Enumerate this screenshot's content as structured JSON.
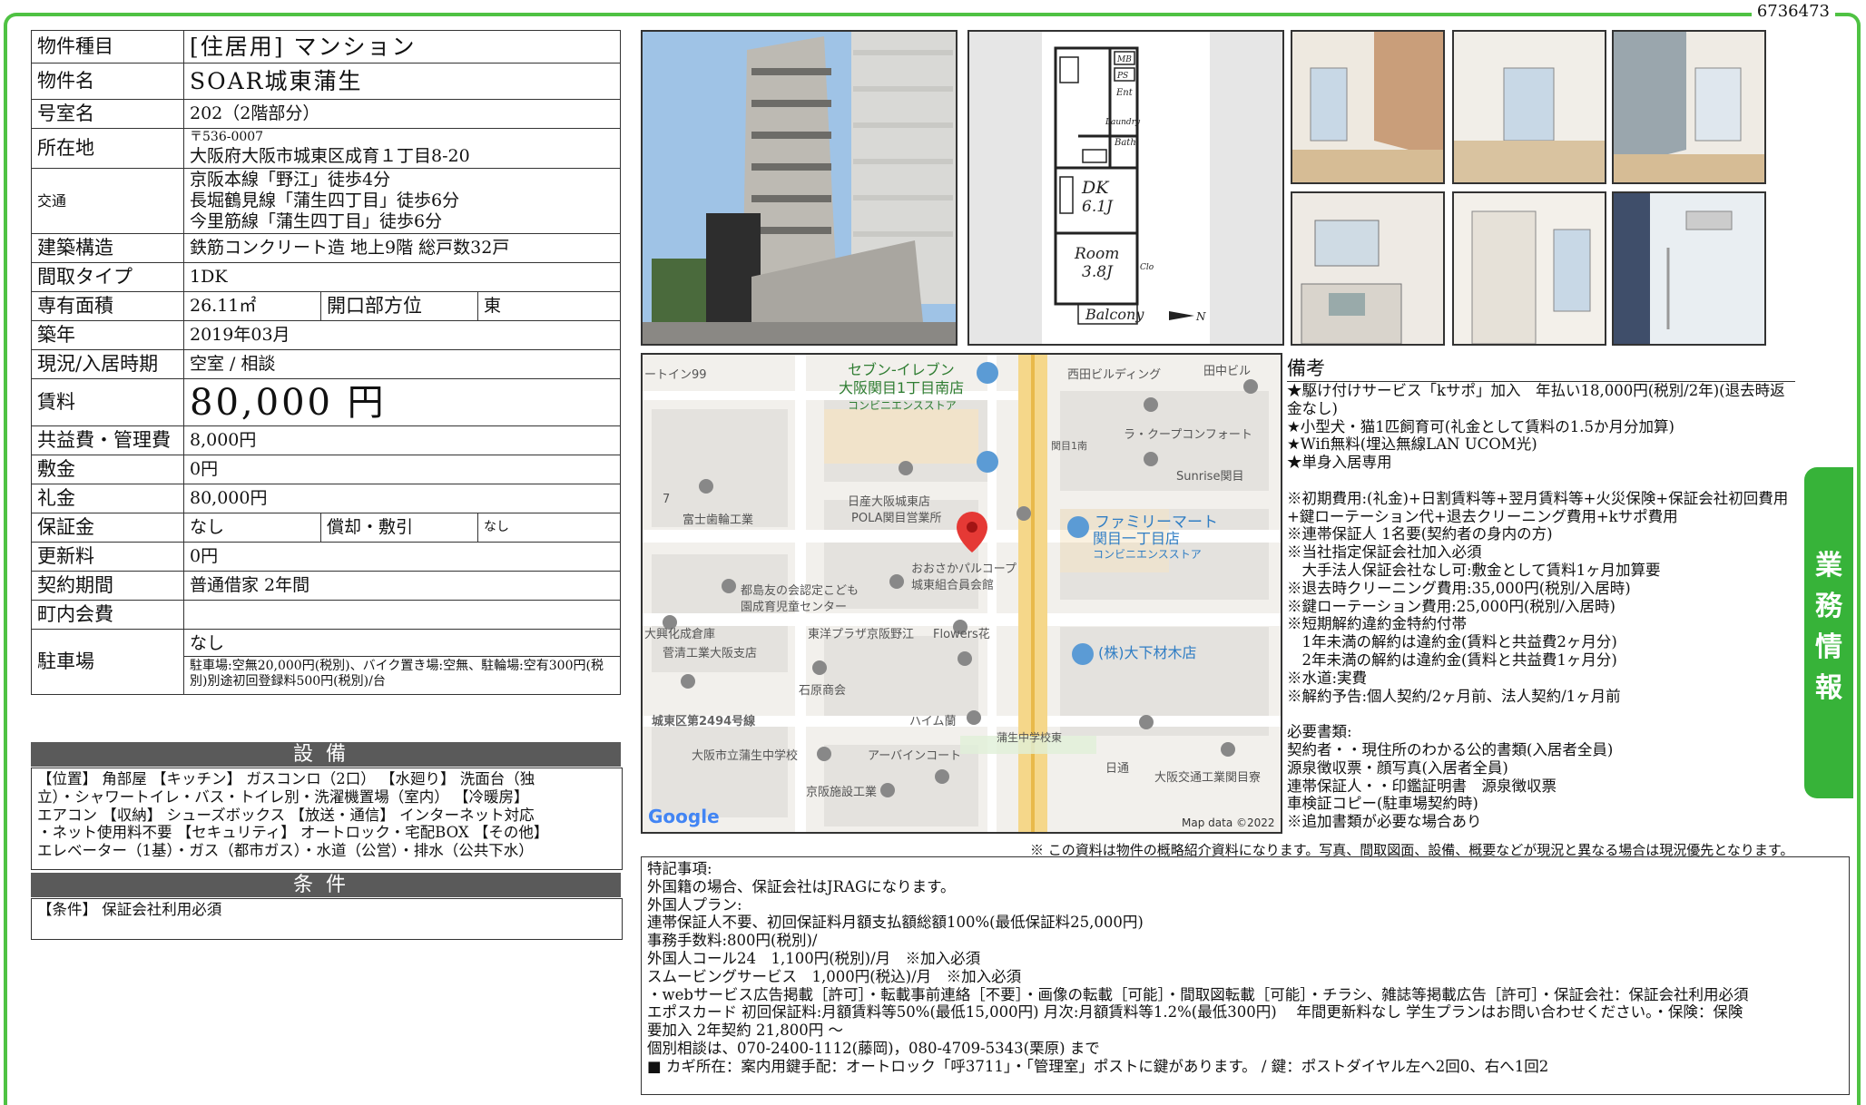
{
  "property_id": "6736473",
  "table": {
    "type_label": "物件種目",
    "type_value": "[住居用] マンション",
    "name_label": "物件名",
    "name_value": "SOAR城東蒲生",
    "room_label": "号室名",
    "room_value": "202（2階部分）",
    "addr_label": "所在地",
    "addr_zip": "〒536-0007",
    "addr_value": "大阪府大阪市城東区成育１丁目8-20",
    "traffic_label": "交通",
    "traffic_1": "京阪本線「野江」徒歩4分",
    "traffic_2": "長堀鶴見線「蒲生四丁目」徒歩6分",
    "traffic_3": "今里筋線「蒲生四丁目」徒歩6分",
    "struct_label": "建築構造",
    "struct_value": "鉄筋コンクリート造 地上9階 総戸数32戸",
    "layout_label": "間取タイプ",
    "layout_value": "1DK",
    "area_label": "専有面積",
    "area_value": "26.11㎡",
    "dir_label": "開口部方位",
    "dir_value": "東",
    "built_label": "築年",
    "built_value": "2019年03月",
    "status_label": "現況/入居時期",
    "status_value": "空室 / 相談",
    "rent_label": "賃料",
    "rent_value": "80,000 円",
    "fee_label": "共益費・管理費",
    "fee_value": "8,000円",
    "deposit_label": "敷金",
    "deposit_value": "0円",
    "key_label": "礼金",
    "key_value": "80,000円",
    "guar_label": "保証金",
    "guar_value": "なし",
    "amort_label": "償却・敷引",
    "amort_value": "なし",
    "renew_label": "更新料",
    "renew_value": "0円",
    "contract_label": "契約期間",
    "contract_value": "普通借家 2年間",
    "town_label": "町内会費",
    "town_value": "",
    "parking_label": "駐車場",
    "parking_value": "なし",
    "parking_detail": "駐車場:空無20,000円(税別)、バイク置き場:空無、駐輪場:空有300円(税別)別途初回登録料500円(税別)/台"
  },
  "equipment": {
    "title": "設備",
    "lines": [
      "【位置】 角部屋 【キッチン】 ガスコンロ（2口） 【水廻り】 洗面台（独",
      "立）・シャワートイレ・バス・トイレ別・洗濯機置場（室内） 【冷暖房】",
      "エアコン 【収納】 シューズボックス 【放送・通信】 インターネット対応",
      "・ネット使用料不要 【セキュリティ】 オートロック・宅配BOX 【その他】",
      "エレベーター（1基）・ガス（都市ガス）・水道（公営）・排水（公共下水）"
    ]
  },
  "conditions": {
    "title": "条件",
    "text": "【条件】 保証会社利用必須"
  },
  "floorplan": {
    "labels": [
      "MB",
      "PS",
      "Ent",
      "Laundry",
      "Bath",
      "DK",
      "6.1J",
      "Room",
      "3.8J",
      "Clo",
      "Balcony",
      "N"
    ]
  },
  "map": {
    "labels": [
      "ートイン99",
      "セブン-イレブン",
      "大阪関目1丁目南店",
      "コンビニエンスストア",
      "西田ビルディング",
      "田中ビル",
      "ラ・クープコンフォート",
      "関目1南",
      "Sunrise関目",
      "7",
      "日産大阪城東店",
      "POLA関目営業所",
      "富士歯輪工業",
      "ファミリーマート",
      "関目一丁目店",
      "コンビニエンスストア",
      "おおさかパルコープ",
      "城東組合員会館",
      "都島友の会認定こども",
      "園成育児童センター",
      "大興化成倉庫",
      "東洋プラザ京阪野江",
      "Flowers花",
      "菅清工業大阪支店",
      "(株)大下材木店",
      "石原商会",
      "城東区第2494号線",
      "ハイム蘭",
      "蒲生中学校東",
      "大阪市立蒲生中学校",
      "アーバインコート",
      "日通",
      "大阪交通工業関目寮",
      "京阪施設工業",
      "Google",
      "Map data ©2022"
    ]
  },
  "remarks": {
    "title": "備考",
    "text": "★駆け付けサービス「kサポ」加入　年払い18,000円(税別/2年)(退去時返金なし)\n★小型犬・猫1匹飼育可(礼金として賃料の1.5か月分加算)\n★Wifi無料(埋込無線LAN UCOM光)\n★単身入居専用\n\n※初期費用:(礼金)+日割賃料等+翌月賃料等+火災保険+保証会社初回費用+鍵ローテーション代+退去クリーニング費用+kサポ費用\n※連帯保証人 1名要(契約者の身内の方)\n※当社指定保証会社加入必須\n　大手法人保証会社なし可:敷金として賃料1ヶ月加算要\n※退去時クリーニング費用:35,000円(税別/入居時)\n※鍵ローテーション費用:25,000円(税別/入居時)\n※短期解約違約金特約付帯\n　1年未満の解約は違約金(賃料と共益費2ヶ月分)\n　2年未満の解約は違約金(賃料と共益費1ヶ月分)\n※水道:実費\n※解約予告:個人契約/2ヶ月前、法人契約/1ヶ月前\n\n必要書類:\n契約者・・現住所のわかる公的書類(入居者全員)\n源泉徴収票・顔写真(入居者全員)\n連帯保証人・・印鑑証明書　源泉徴収票\n車検証コピー(駐車場契約時)\n※追加書類が必要な場合あり"
  },
  "disclaimer": "※ この資料は物件の概略紹介資料になります。写真、間取図面、設備、概要などが現況と異なる場合は現況優先となります。",
  "notes": [
    "特記事項:",
    "外国籍の場合、保証会社はJRAGになります。",
    "外国人プラン:",
    "連帯保証人不要、初回保証料月額支払額総額100%(最低保証料25,000円)",
    "事務手数料:800円(税別)/",
    "外国人コール24　1,100円(税別)/月　※加入必須",
    "スムービングサービス　1,000円(税込)/月　※加入必須",
    "・webサービス広告掲載［許可］・転載事前連絡［不要］・画像の転載［可能］・間取図転載［可能］・チラシ、雑誌等掲載広告［許可］・保証会社：保証会社利用必須",
    " エポスカード 初回保証料:月額賃料等50%(最低15,000円) 月次:月額賃料等1.2%(最低300円)　 年間更新料なし 学生プランはお問い合わせください。・保険：保険",
    "要加入 2年契約 21,800円 ～",
    "個別相談は、070-2400-1112(藤岡)，080-4709-5343(栗原) まで",
    "■ カギ所在：案内用鍵手配：オートロック「呼3711」・「管理室」ポストに鍵があります。 / 鍵：ポストダイヤル左へ2回0、右へ1回2"
  ],
  "side_tab": [
    "業",
    "務",
    "情",
    "報"
  ]
}
